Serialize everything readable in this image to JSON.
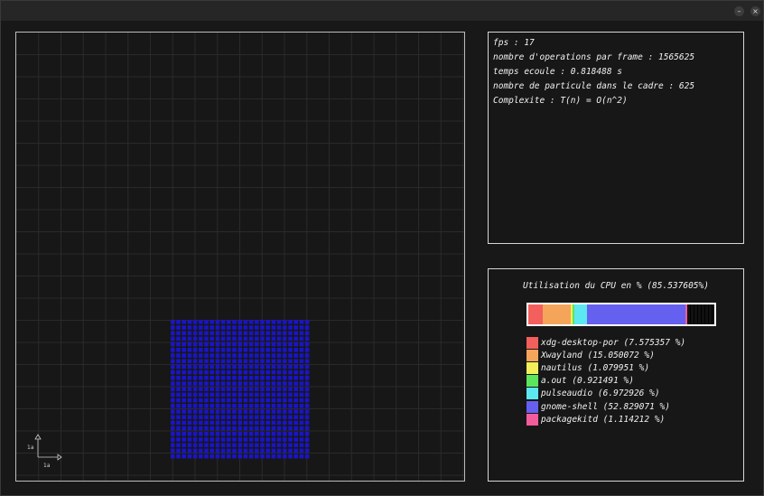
{
  "window": {
    "minimize_icon": "minimize-icon",
    "close_icon": "close-icon",
    "minimize_glyph": "–",
    "close_glyph": "×"
  },
  "simulation": {
    "axis_y_label": "1a",
    "axis_x_label": "1a",
    "particle_color": "#1a14c8",
    "particle_count": 625
  },
  "info": {
    "fps": "fps : 17",
    "operations": "nombre d'operations par frame : 1565625",
    "elapsed": "temps ecoule : 0.818488 s",
    "particles": "nombre de particule dans le cadre : 625",
    "complexity": "Complexite : T(n) = O(n^2)"
  },
  "cpu": {
    "title": "Utilisation du CPU en % (85.537605%)",
    "total_percent": 85.537605,
    "processes": [
      {
        "label": "xdg-desktop-por (7.575357 %)",
        "percent": 7.575357,
        "color": "#f25f5c"
      },
      {
        "label": "Xwayland (15.050072 %)",
        "percent": 15.050072,
        "color": "#f5a55a"
      },
      {
        "label": "nautilus (1.079951 %)",
        "percent": 1.079951,
        "color": "#f2ef5a"
      },
      {
        "label": "a.out (0.921491 %)",
        "percent": 0.921491,
        "color": "#5ce65c"
      },
      {
        "label": "pulseaudio (6.972926 %)",
        "percent": 6.972926,
        "color": "#5ce8f0"
      },
      {
        "label": "gnome-shell (52.829071 %)",
        "percent": 52.829071,
        "color": "#6560ef"
      },
      {
        "label": "packagekitd (1.114212 %)",
        "percent": 1.114212,
        "color": "#f25c9c"
      }
    ]
  }
}
